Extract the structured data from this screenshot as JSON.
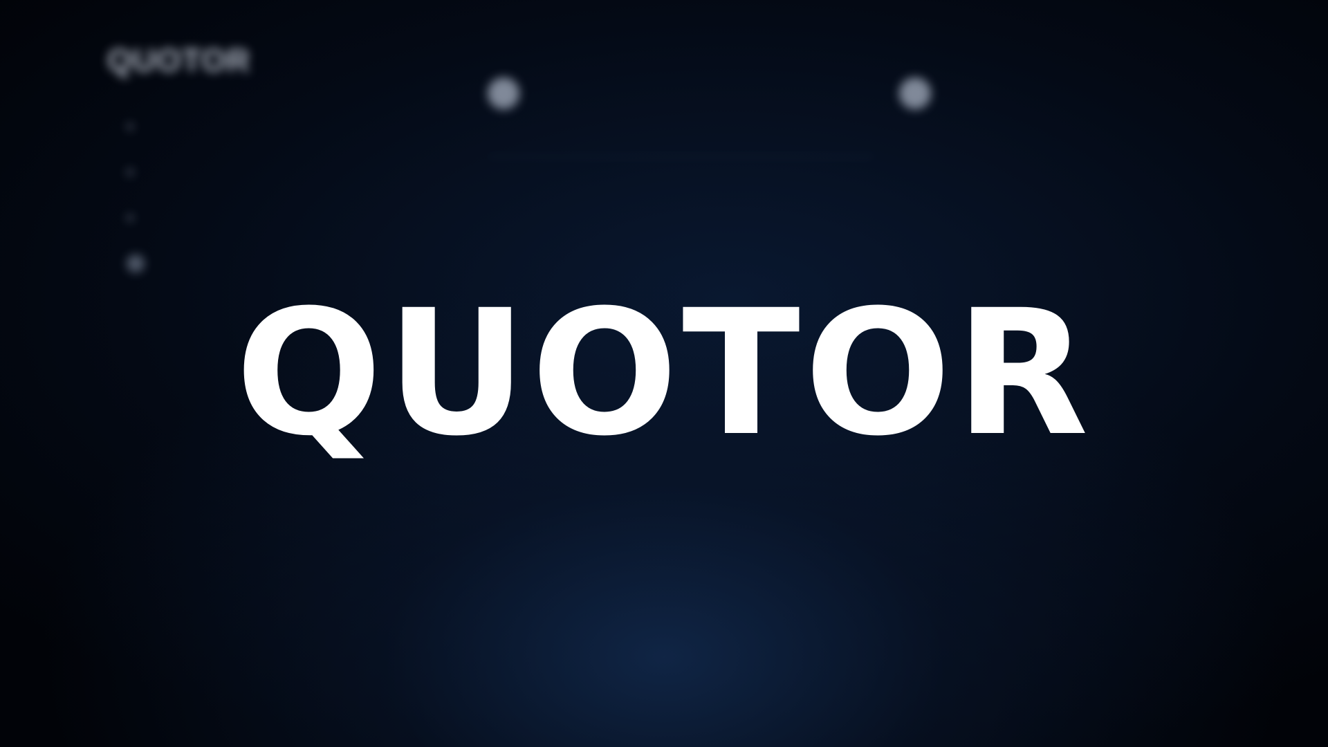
{
  "app": {
    "title": "QUOTOR"
  },
  "colors": {
    "background": "#02050b",
    "glow": "#122a4e",
    "wordmark": "#ffffff"
  },
  "background_app": {
    "sidebar": {
      "brand": "QUOTOR",
      "subtitle": "",
      "items": [
        {
          "label": "",
          "icon": "dot-icon"
        },
        {
          "label": "",
          "icon": "dot-icon"
        },
        {
          "label": "",
          "icon": "dot-icon"
        },
        {
          "label": "",
          "icon": "avatar-icon"
        }
      ]
    },
    "feed": {
      "heading": "",
      "post": {
        "author": "",
        "text": "",
        "actions": [
          "",
          ""
        ]
      }
    },
    "trending": {
      "heading": "",
      "post": {
        "author": "",
        "text": ""
      }
    }
  }
}
